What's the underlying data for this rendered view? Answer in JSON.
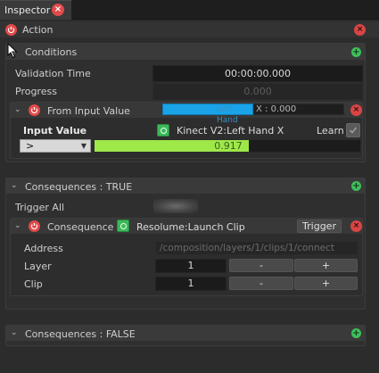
{
  "tab": {
    "title": "Inspector",
    "close": "×"
  },
  "action": {
    "title": "Action",
    "close": "×"
  },
  "conditions": {
    "title": "Conditions",
    "add": "+",
    "validation_time_label": "Validation Time",
    "validation_time_value": "00:00:00.000",
    "progress_label": "Progress",
    "progress_value": "0.000",
    "from_input": {
      "title": "From Input Value",
      "bar_text": "Left Hand",
      "x_text": "X : 0.000",
      "close": "×",
      "input_value_label": "Input Value",
      "target": "Kinect V2:Left Hand X",
      "learn_label": "Learn",
      "operator": ">",
      "slider_value": "0.917",
      "slider_fill": 0.58
    }
  },
  "consequences_true": {
    "title": "Consequences : TRUE",
    "add": "+",
    "trigger_all_label": "Trigger All",
    "consequence": {
      "title": "Consequence",
      "target": "Resolume:Launch Clip",
      "trigger_label": "Trigger",
      "close": "×",
      "address_label": "Address",
      "address_value": "/composition/layers/1/clips/1/connect",
      "layer_label": "Layer",
      "layer_value": "1",
      "clip_label": "Clip",
      "clip_value": "1",
      "minus": "-",
      "plus": "+"
    }
  },
  "consequences_false": {
    "title": "Consequences : FALSE",
    "add": "+"
  },
  "colors": {
    "accent_green": "#3fbf5a",
    "close_red": "#e04a4a",
    "bar_blue": "#1aa3e8",
    "slider_green": "#9ee84a"
  }
}
